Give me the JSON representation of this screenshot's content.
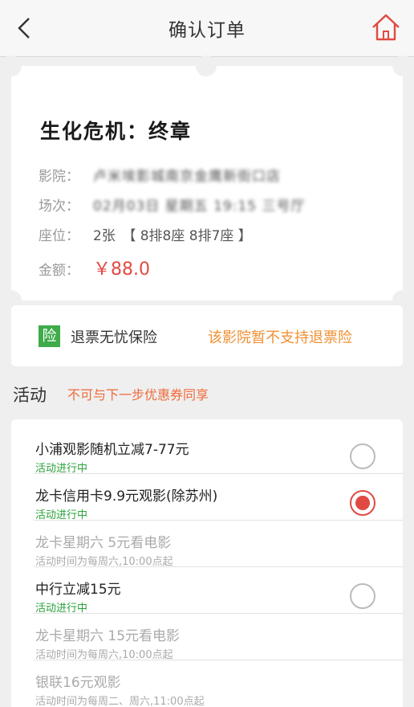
{
  "header": {
    "title": "确认订单",
    "back_icon": "chevron-left-icon",
    "home_icon": "home-icon",
    "home_color": "#e04a43"
  },
  "ticket": {
    "movie": "生化危机：终章",
    "cinema_label": "影院：",
    "cinema_value": "卢米埃影城南京金鹰新街口店",
    "session_label": "场次：",
    "session_value": "02月03日 星期五 19:15 三号厅",
    "seat_label": "座位：",
    "seat_value": "2张　【 8排8座 8排7座 】",
    "amount_label": "金额：",
    "amount_value": "￥88.0"
  },
  "insurance": {
    "icon_text": "险",
    "label": "退票无忧保险",
    "note": "该影院暂不支持退票险"
  },
  "activities": {
    "title": "活动",
    "note": "不可与下一步优惠券同享",
    "items": [
      {
        "name": "小浦观影随机立减7-77元",
        "status": "活动进行中",
        "enabled": true,
        "selected": false
      },
      {
        "name": "龙卡信用卡9.9元观影(除苏州)",
        "status": "活动进行中",
        "enabled": true,
        "selected": true
      },
      {
        "name": "龙卡星期六 5元看电影",
        "status": "活动时间为每周六,10:00点起",
        "enabled": false,
        "selected": false
      },
      {
        "name": "中行立减15元",
        "status": "活动进行中",
        "enabled": true,
        "selected": false
      },
      {
        "name": "龙卡星期六 15元看电影",
        "status": "活动时间为每周六,10:00点起",
        "enabled": false,
        "selected": false
      },
      {
        "name": "银联16元观影",
        "status": "活动时间为每周二、周六,11:00点起",
        "enabled": false,
        "selected": false
      }
    ]
  },
  "colors": {
    "accent": "#e04a43",
    "active_status": "#2aa13a",
    "warning": "#f09033"
  }
}
